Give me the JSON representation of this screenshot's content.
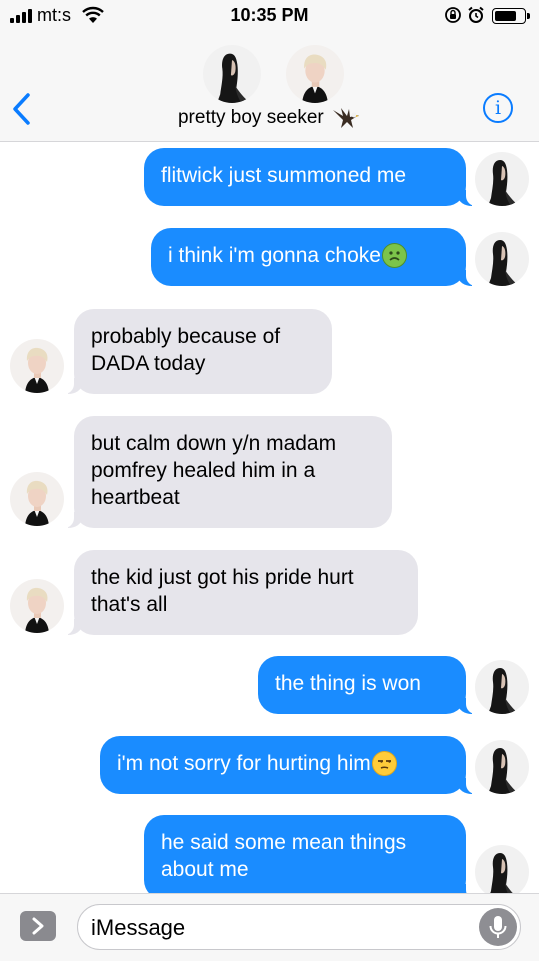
{
  "status_bar": {
    "carrier": "mt:s",
    "time": "10:35 PM",
    "battery_level": 0.75
  },
  "header": {
    "contact_name": "pretty boy seeker",
    "back_icon": "chevron-left-icon",
    "info_icon": "info-icon",
    "name_emoji": "eagle-icon"
  },
  "messages": [
    {
      "direction": "outgoing",
      "text": "flitwick just summoned me"
    },
    {
      "direction": "outgoing",
      "text": "i think i'm gonna choke",
      "emoji": "nauseated-face-icon"
    },
    {
      "direction": "incoming",
      "text": "probably because of DADA today"
    },
    {
      "direction": "incoming",
      "text": "but calm down y/n madam pomfrey healed him in a heartbeat"
    },
    {
      "direction": "incoming",
      "text": "the kid just got his pride hurt that's all"
    },
    {
      "direction": "outgoing",
      "text": "the thing is won"
    },
    {
      "direction": "outgoing",
      "text": "i'm not sorry for hurting him",
      "emoji": "unamused-face-icon"
    },
    {
      "direction": "outgoing",
      "text": "he said some mean things about me"
    }
  ],
  "input": {
    "placeholder": "iMessage",
    "apps_icon": "app-drawer-icon",
    "mic_icon": "microphone-icon"
  },
  "colors": {
    "outgoing_bubble": "#1a8cff",
    "incoming_bubble": "#e6e5eb",
    "accent": "#0a7cff"
  }
}
